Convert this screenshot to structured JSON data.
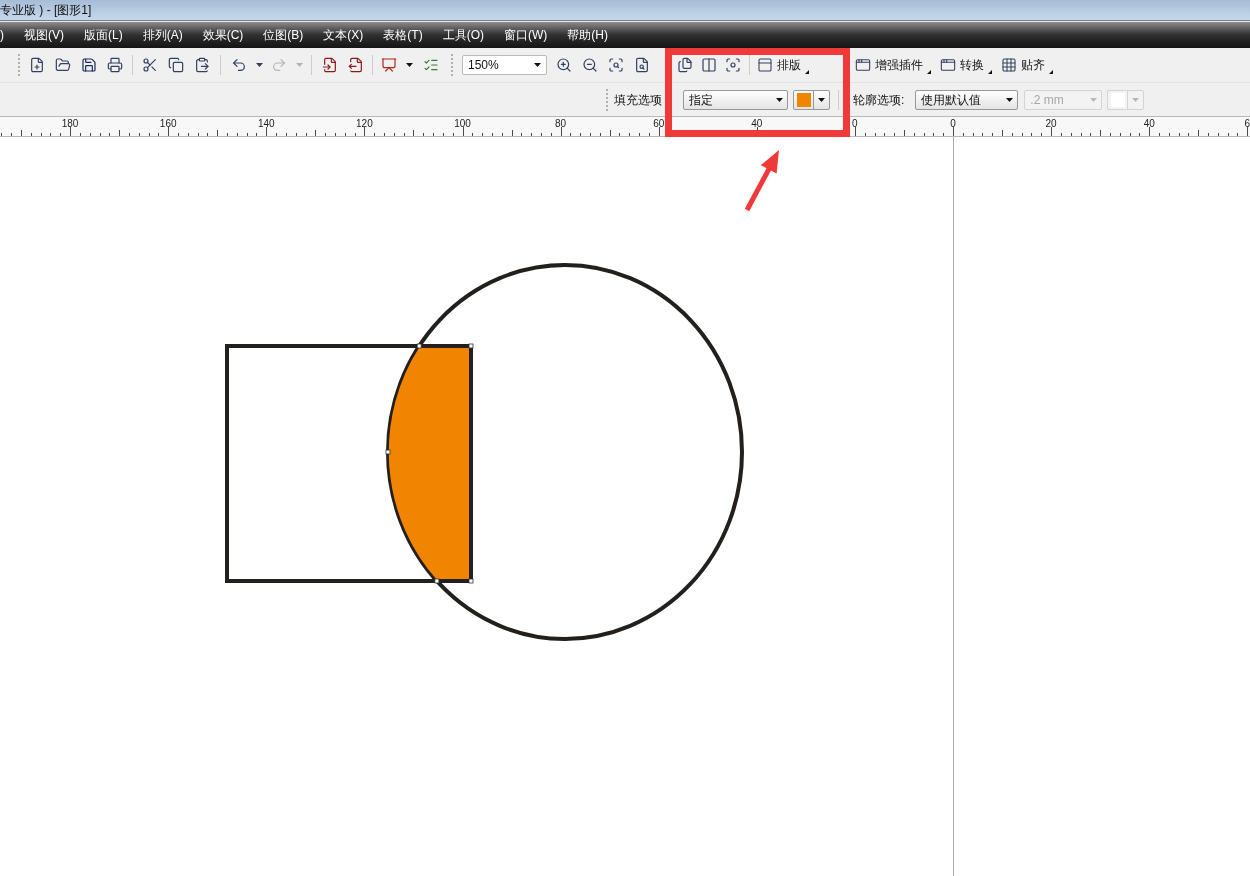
{
  "title_bar": {
    "title": "专业版 ) - [图形1]"
  },
  "menu_bar": {
    "items": [
      ")",
      "视图(V)",
      "版面(L)",
      "排列(A)",
      "效果(C)",
      "位图(B)",
      "文本(X)",
      "表格(T)",
      "工具(O)",
      "窗口(W)",
      "帮助(H)"
    ]
  },
  "toolbar": {
    "undo": {
      "disabled": false
    },
    "redo": {
      "disabled": true
    },
    "zoom_level": "150%",
    "tool_buttons": [
      {
        "label": "排版"
      },
      {
        "label": "增强插件"
      },
      {
        "label": "转换"
      },
      {
        "label": "贴齐"
      }
    ]
  },
  "property_bar": {
    "fill_label": "填充选项",
    "fill_type": {
      "value": "指定",
      "disabled": false
    },
    "fill_color": {
      "color": "#f18400",
      "disabled": false
    },
    "outline_label": "轮廓选项:",
    "outline_type": {
      "value": "使用默认值",
      "disabled": false
    },
    "outline_width": {
      "value": ".2 mm",
      "disabled": true
    },
    "outline_color": {
      "color": "#ffffff",
      "disabled": true
    }
  },
  "ruler": {
    "labels": [
      "180",
      "160",
      "140",
      "120",
      "100",
      "80",
      "60",
      "40",
      "0",
      "0",
      "20",
      "40",
      "6"
    ]
  }
}
